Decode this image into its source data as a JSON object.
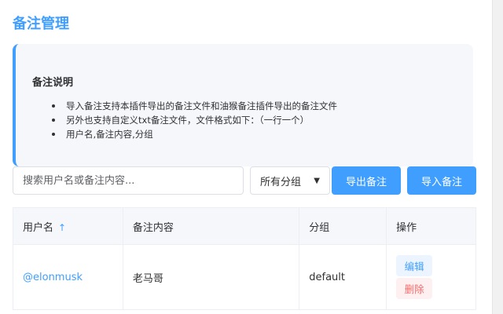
{
  "header": {
    "title": "备注管理"
  },
  "info": {
    "title": "备注说明",
    "items": [
      "导入备注支持本插件导出的备注文件和油猴备注插件导出的备注文件",
      "另外也支持自定义txt备注文件，文件格式如下：（一行一个）",
      "用户名,备注内容,分组"
    ]
  },
  "toolbar": {
    "search_placeholder": "搜索用户名或备注内容...",
    "group_select": "所有分组",
    "export_label": "导出备注",
    "import_label": "导入备注"
  },
  "table": {
    "headers": [
      "用户名",
      "备注内容",
      "分组",
      "操作"
    ],
    "sort_indicator": "↑",
    "rows": [
      {
        "username": "@elonmusk",
        "note": "老马哥",
        "group": "default",
        "edit_label": "编辑",
        "delete_label": "删除"
      }
    ]
  },
  "colors": {
    "accent": "#409eff",
    "danger": "#f56c6c"
  }
}
